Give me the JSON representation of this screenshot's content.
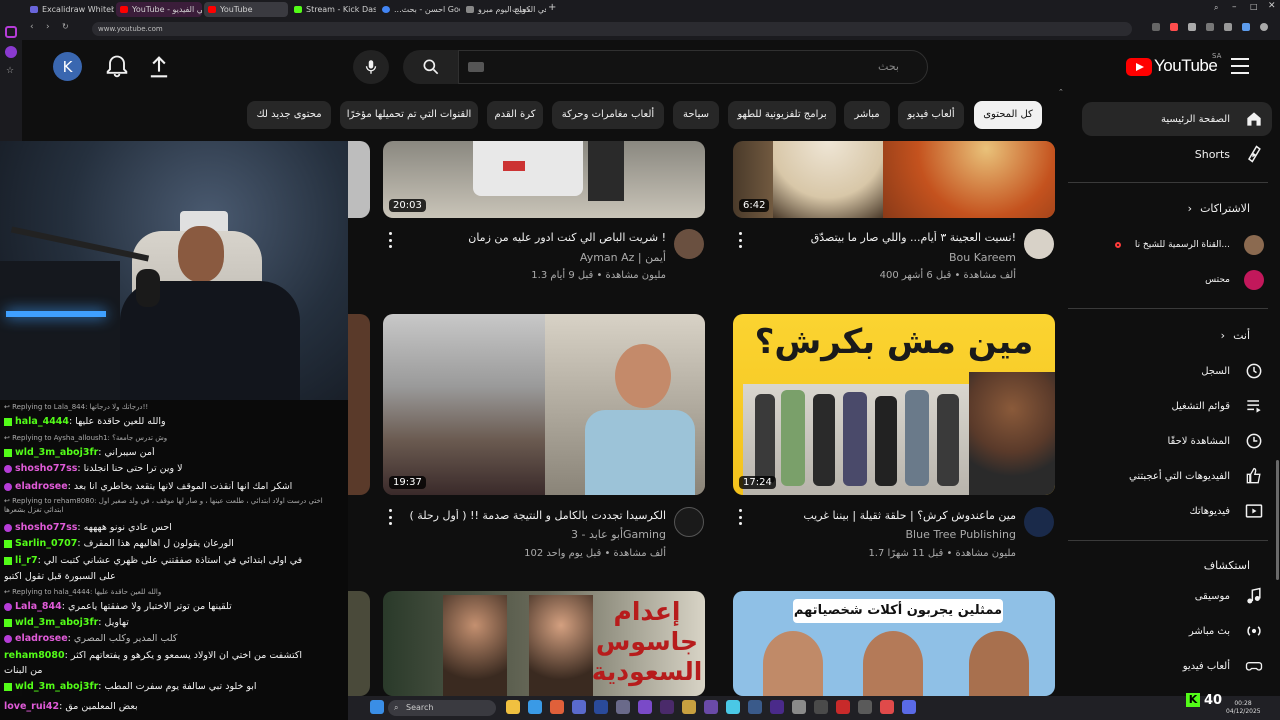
{
  "browser": {
    "tabs": [
      {
        "label": "Excalidraw Whiteboard",
        "color": "#6965db",
        "style": "normal"
      },
      {
        "label": "YouTube - حلي الفيديو",
        "color": "#ff0000",
        "style": "purple"
      },
      {
        "label": "YouTube",
        "color": "#ff0000",
        "style": "active"
      },
      {
        "label": "Stream - Kick Dashboard",
        "color": "#53fc18",
        "style": "normal"
      },
      {
        "label": "...احسن - بحث Google",
        "color": "#4285f4",
        "style": "normal"
      },
      {
        "label": "دجاج اليوم مبرو",
        "color": "#888888",
        "style": "normal"
      },
      {
        "label": "اسوق التميم في الكويت",
        "color": "#888888",
        "style": "normal"
      }
    ],
    "url": "www.youtube.com"
  },
  "youtube": {
    "logo_text": "YouTube",
    "region": "SA",
    "avatar_letter": "K",
    "search_placeholder": "بحث",
    "chips": [
      {
        "label": "كل المحتوى",
        "selected": true
      },
      {
        "label": "ألعاب فيديو",
        "selected": false
      },
      {
        "label": "مباشر",
        "selected": false
      },
      {
        "label": "برامج تلفزيونية للطهو",
        "selected": false
      },
      {
        "label": "سياحة",
        "selected": false
      },
      {
        "label": "ألعاب مغامرات وحركة",
        "selected": false
      },
      {
        "label": "كرة القدم",
        "selected": false
      },
      {
        "label": "القنوات التي تم تحميلها مؤخرًا",
        "selected": false
      },
      {
        "label": "محتوى جديد لك",
        "selected": false
      }
    ],
    "sidebar": {
      "home": "الصفحة الرئيسية",
      "shorts": "Shorts",
      "subscriptions_heading": "الاشتراكات",
      "subs": [
        {
          "label": "القناة الرسمية للشيخ نا..."
        },
        {
          "label": "محتس"
        }
      ],
      "you_heading": "أنت",
      "you_items": [
        {
          "label": "السجل",
          "icon": "history-icon"
        },
        {
          "label": "قوائم التشغيل",
          "icon": "playlist-icon"
        },
        {
          "label": "المشاهدة لاحقًا",
          "icon": "clock-icon"
        },
        {
          "label": "الفيديوهات التي أعجبتني",
          "icon": "thumbs-up-icon"
        },
        {
          "label": "فيديوهاتك",
          "icon": "video-icon"
        }
      ],
      "explore_heading": "استكشاف",
      "explore_items": [
        {
          "label": "موسيقى",
          "icon": "music-icon"
        },
        {
          "label": "بث مباشر",
          "icon": "live-icon"
        },
        {
          "label": "ألعاب فيديو",
          "icon": "gamepad-icon"
        }
      ]
    },
    "videos": [
      {
        "title": "نسيت العجينة ٣ أيام... واللي صار ما بيتصدّق!",
        "channel": "Bou Kareem",
        "meta": "400 ألف مشاهدة • قبل 6 أشهر",
        "duration": "6:42"
      },
      {
        "title": "شريت الباص الي كنت ادور عليه من زمان !",
        "channel": "Ayman Az | أيمن",
        "meta": "1.3 مليون مشاهدة • قبل 9 أيام",
        "duration": "20:03"
      },
      {
        "title": "مين ماعندوش كرش؟ | حلقة ثقيلة | بيننا غريب",
        "channel": "Blue Tree Publishing",
        "meta": "1.7 مليون مشاهدة • قبل 11 شهرًا",
        "duration": "17:24",
        "thumb_text": "مين مش بكرش؟"
      },
      {
        "title": "الكرسيدا تجددت بالكامل و النتيجة صدمة !! ( أول رحلة )",
        "channel": "أبو عابد - 3Gaming",
        "meta": "102 ألف مشاهدة • قبل يوم واحد",
        "duration": "19:37"
      },
      {
        "title": "",
        "channel": "",
        "meta": "",
        "duration": "",
        "thumb_text": "ممثلين يجربون أكلات شخصياتهم"
      },
      {
        "title": "",
        "channel": "",
        "meta": "",
        "duration": "",
        "thumb_text": "إعدام جاسوس السعودية"
      }
    ]
  },
  "chat": {
    "lines": [
      {
        "type": "reply",
        "text": "Replying to Lala_844: درجاتك ولا درجاتها!!"
      },
      {
        "type": "msg",
        "user": "hala_4444",
        "ucolor": "#53fc18",
        "text": "والله للعين حاقدة عليها"
      },
      {
        "type": "reply",
        "text": "Replying to Aysha_alloush1: وش تدرس جامعة؟"
      },
      {
        "type": "msg",
        "user": "wld_3m_aboj3fr",
        "ucolor": "#53fc18",
        "text": "أمن سيبراني"
      },
      {
        "type": "msg",
        "user": "shosho77ss",
        "ucolor": "#e05bd8",
        "text": "لا وين ترا حتى حنا انجلدنا"
      },
      {
        "type": "msg",
        "user": "eladrosee",
        "ucolor": "#e05bd8",
        "text": "اشكر امك انها أنقذت الموقف لانها بتقعد بخاطري انا بعد"
      },
      {
        "type": "reply",
        "text": "Replying to reham8080: اختي درست اولاد ابتدائي ، طلعت عينها ، و صار لها موقف ، في ولد صغير اول ابتدائي تغزل بشعرها"
      },
      {
        "type": "msg",
        "user": "shosho77ss",
        "ucolor": "#e05bd8",
        "text": "احس عادي نونو ههههه"
      },
      {
        "type": "msg",
        "user": "Sarlin_0707",
        "ucolor": "#53fc18",
        "text": "الورعان يقولون ل اهاليهم هذا المقرف"
      },
      {
        "type": "msg",
        "user": "li_r7",
        "ucolor": "#53fc18",
        "text": "في اولى ابتدائي في استاذة صفقتني على ظهري عشاني كتبت الي"
      },
      {
        "type": "cont",
        "text": "على السبورة قبل تقول اكتبو"
      },
      {
        "type": "reply",
        "text": "Replying to hala_4444: والله للعين حاقدة عليها"
      },
      {
        "type": "msg",
        "user": "Lala_844",
        "ucolor": "#e05bd8",
        "text": "تلقينها من توتر الاختبار ولا صفقتها ياعمري"
      },
      {
        "type": "msg",
        "user": "wld_3m_aboj3fr",
        "ucolor": "#53fc18",
        "text": "تهاويل"
      },
      {
        "type": "msg",
        "user": "eladrosee",
        "ucolor": "#e05bd8",
        "text": "كلب المدير وكلب المصري"
      },
      {
        "type": "msg",
        "user": "reham8080",
        "ucolor": "#53fc18",
        "text": "اكتشفت من اختي ان الاولاد يسمعو و يكرهو و يفتعاتهم اكثر"
      },
      {
        "type": "cont",
        "text": "من البنات"
      },
      {
        "type": "msg",
        "user": "wld_3m_aboj3fr",
        "ucolor": "#53fc18",
        "text": "ابو خلود تبي سالفة يوم سفرت المطب"
      },
      {
        "type": "msg",
        "user": "love_rui42",
        "ucolor": "#e05bd8",
        "text": "بعض المعلمين مق"
      }
    ]
  },
  "taskbar": {
    "search_label": "Search",
    "kick_viewers": "40",
    "time": "00:28",
    "date": "04/12/2025"
  },
  "colors": {
    "accent_red": "#ff0000",
    "kick_green": "#53fc18"
  }
}
